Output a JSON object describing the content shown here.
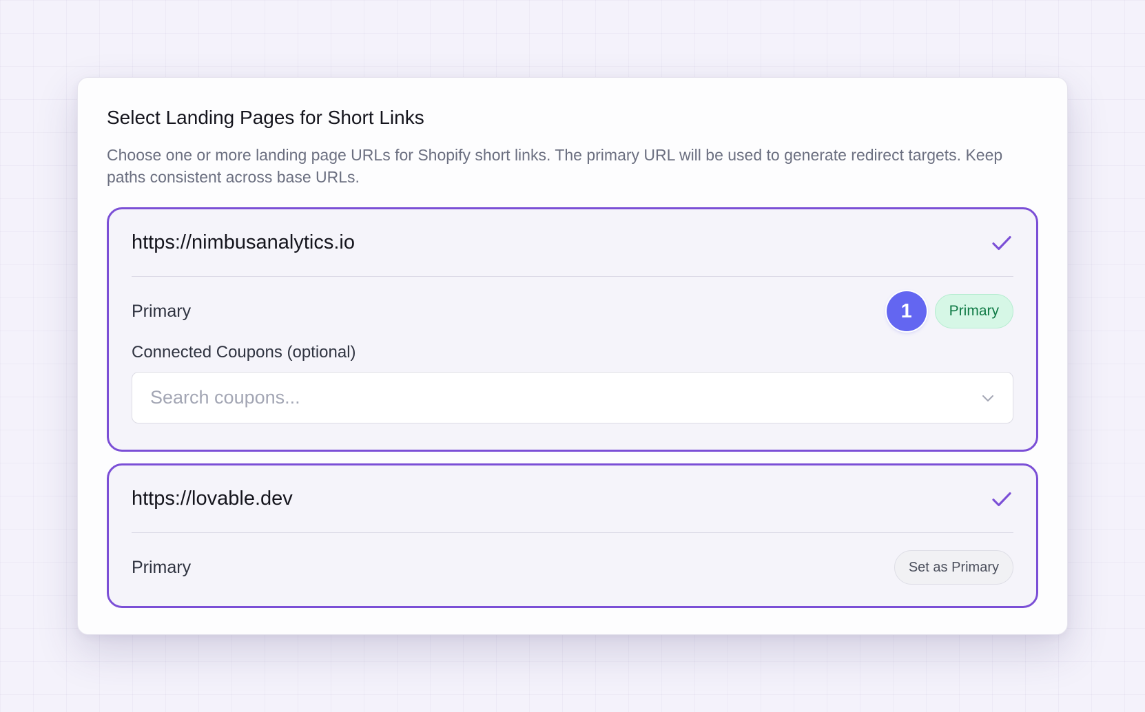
{
  "dialog": {
    "title": "Select Landing Pages for Short Links",
    "description": "Choose one or more landing page URLs for Shopify short links. The primary URL will be used to generate redirect targets. Keep paths consistent across base URLs."
  },
  "landing_pages": [
    {
      "url": "https://nimbusanalytics.io",
      "selected": true,
      "primary_label": "Primary",
      "order_number": "1",
      "status_badge": "Primary",
      "coupons_label": "Connected Coupons (optional)",
      "coupons_placeholder": "Search coupons..."
    },
    {
      "url": "https://lovable.dev",
      "selected": true,
      "primary_label": "Primary",
      "set_primary_label": "Set as Primary"
    }
  ],
  "colors": {
    "selected_border": "#7b4fd6",
    "check": "#7b4fd6",
    "order_badge": "#6366f1",
    "primary_badge_bg": "#d6f7e6",
    "primary_badge_text": "#0f7a45"
  },
  "icons": {
    "check": "check-icon",
    "dropdown": "chevron-down-icon"
  }
}
